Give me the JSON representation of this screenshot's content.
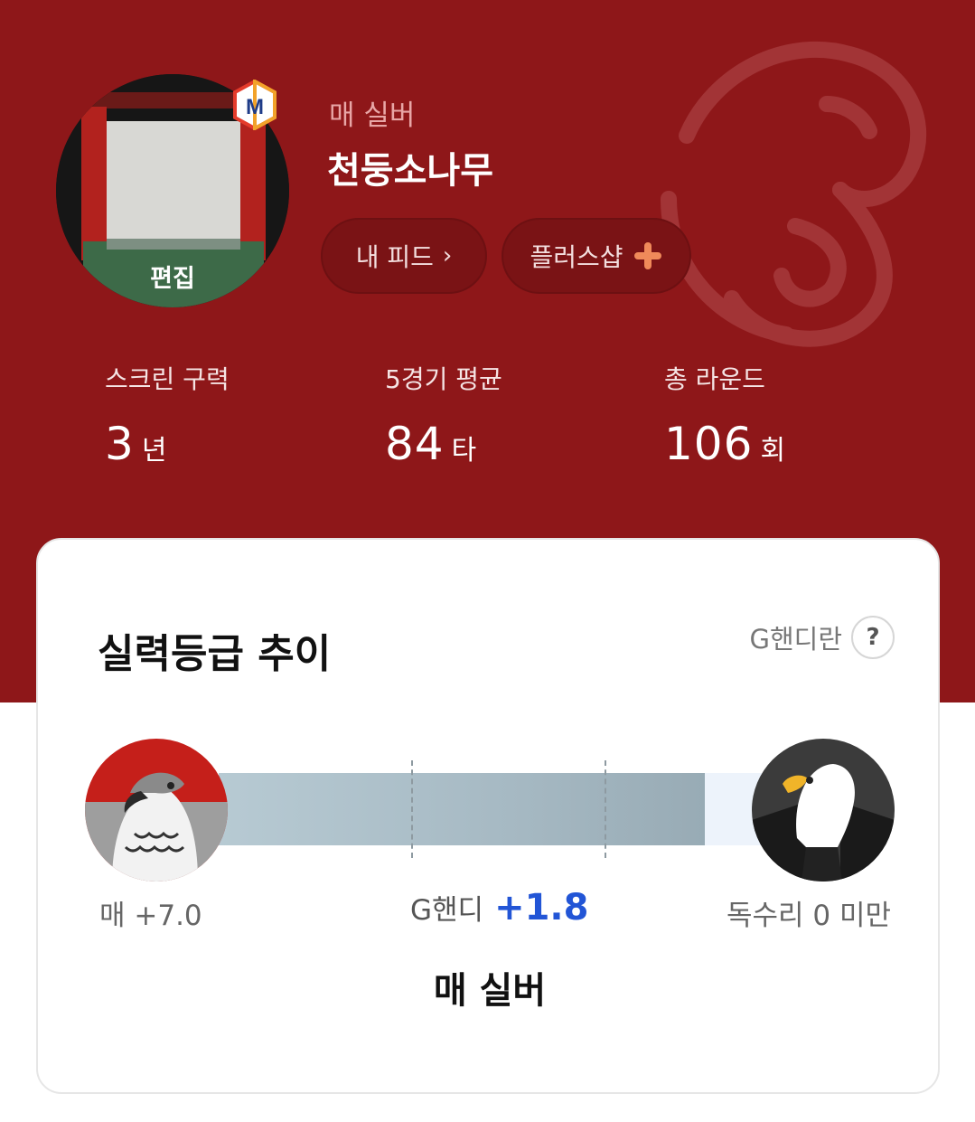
{
  "profile": {
    "grade_label": "매 실버",
    "nickname": "천둥소나무",
    "avatar_edit_label": "편집",
    "badge_letter": "M",
    "accent_color": "#8e1719"
  },
  "buttons": {
    "my_feed": "내 피드",
    "plus_shop": "플러스샵"
  },
  "stats": [
    {
      "label": "스크린 구력",
      "value": "3",
      "unit": "년"
    },
    {
      "label": "5경기 평균",
      "value": "84",
      "unit": "타"
    },
    {
      "label": "총 라운드",
      "value": "106",
      "unit": "회"
    }
  ],
  "trend": {
    "title": "실력등급 추이",
    "help_label": "G핸디란",
    "help_icon": "?",
    "left_label": "매 +7.0",
    "center_prefix": "G핸디",
    "center_value": "+1.8",
    "right_label": "독수리 0 미만",
    "current_grade": "매 실버",
    "progress_fraction": 0.84,
    "tick_fractions": [
      0.333,
      0.667
    ],
    "icons": {
      "left": "hawk-icon",
      "right": "eagle-icon"
    }
  }
}
